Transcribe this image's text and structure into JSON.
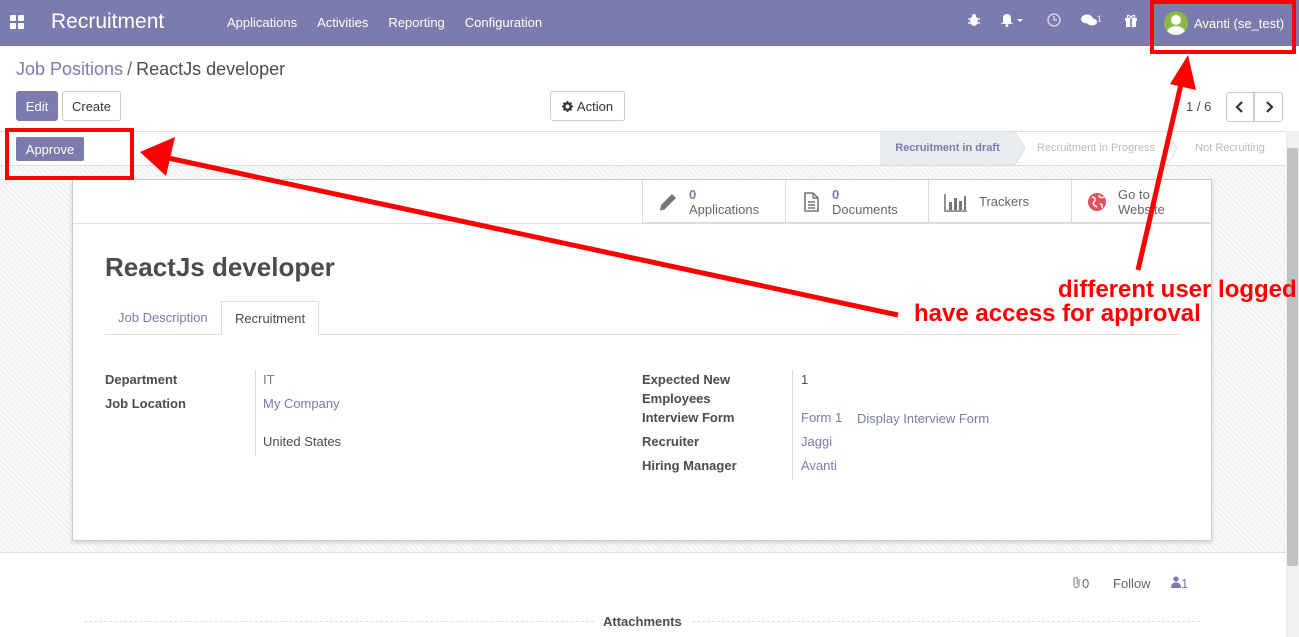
{
  "navbar": {
    "app_title": "Recruitment",
    "menu": [
      "Applications",
      "Activities",
      "Reporting",
      "Configuration"
    ],
    "messages_count": "1",
    "user_name": "Avanti (se_test)"
  },
  "breadcrumb": {
    "parent": "Job Positions",
    "separator": "/",
    "current": "ReactJs developer"
  },
  "control": {
    "edit_label": "Edit",
    "create_label": "Create",
    "action_label": "Action",
    "pager_value": "1 / 6"
  },
  "statusbar": {
    "approve_label": "Approve",
    "stages": [
      "Recruitment in draft",
      "Recruitment in Progress",
      "Not Recruiting"
    ],
    "active_stage": "Recruitment in draft"
  },
  "smart_buttons": [
    {
      "count": "0",
      "label": "Applications",
      "icon": "pencil-icon"
    },
    {
      "count": "0",
      "label": "Documents",
      "icon": "document-icon"
    },
    {
      "count": "",
      "label": "Trackers",
      "icon": "bar-chart-icon"
    },
    {
      "count": "",
      "label": "Go to Website",
      "label_line1": "Go to",
      "label_line2": "Website",
      "icon": "globe-icon"
    }
  ],
  "form": {
    "title": "ReactJs developer",
    "tabs": [
      "Job Description",
      "Recruitment"
    ],
    "active_tab": "Recruitment",
    "left": {
      "department_label": "Department",
      "department_value": "IT",
      "location_label": "Job Location",
      "location_company": "My Company",
      "location_country": "United States"
    },
    "right": {
      "expected_label_1": "Expected New",
      "expected_label_2": "Employees",
      "expected_value": "1",
      "interview_label": "Interview Form",
      "interview_value": "Form 1",
      "interview_link": "Display Interview Form",
      "recruiter_label": "Recruiter",
      "recruiter_value": "Jaggi",
      "manager_label": "Hiring Manager",
      "manager_value": "Avanti"
    }
  },
  "chatter": {
    "attachments_count": "0",
    "follow_label": "Follow",
    "followers_count": "1",
    "attachments_label": "Attachments"
  },
  "annotation": {
    "line1": "different user logged",
    "line2": "have access for approval"
  },
  "colors": {
    "brand": "#7c7bad",
    "annotation": "#ff0000"
  }
}
